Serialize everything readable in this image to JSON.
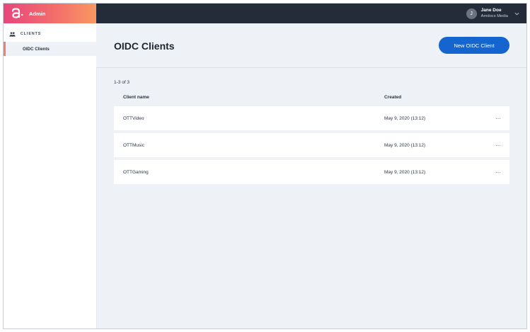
{
  "app": {
    "brand_label": "Admin"
  },
  "user": {
    "initial": "J",
    "name": "Jane Doe",
    "org": "Amdocs Media"
  },
  "sidebar": {
    "section_label": "CLIENTS",
    "items": [
      {
        "label": "OIDC Clients",
        "active": true
      }
    ]
  },
  "main": {
    "title": "OIDC Clients",
    "new_button_label": "New OIDC Client",
    "count_text": "1-3 of 3",
    "columns": [
      "Client name",
      "Created"
    ],
    "rows": [
      {
        "name": "OTTVideo",
        "created": "May 9, 2020 (13:12)",
        "menu": "···"
      },
      {
        "name": "OTTMusic",
        "created": "May 9, 2020 (13:12)",
        "menu": "···"
      },
      {
        "name": "OTTGaming",
        "created": "May 9, 2020 (13:12)",
        "menu": "···"
      }
    ]
  },
  "colors": {
    "accent": "#1565d0",
    "topbar": "#242c39",
    "brand_gradient_start": "#e8467c",
    "brand_gradient_end": "#f99862",
    "background": "#eef1f5"
  },
  "icons": {
    "brand": "amdocs-logo-icon",
    "user_menu": "chevron-down-icon",
    "section": "users-icon",
    "row_menu": "more-horizontal-icon"
  }
}
